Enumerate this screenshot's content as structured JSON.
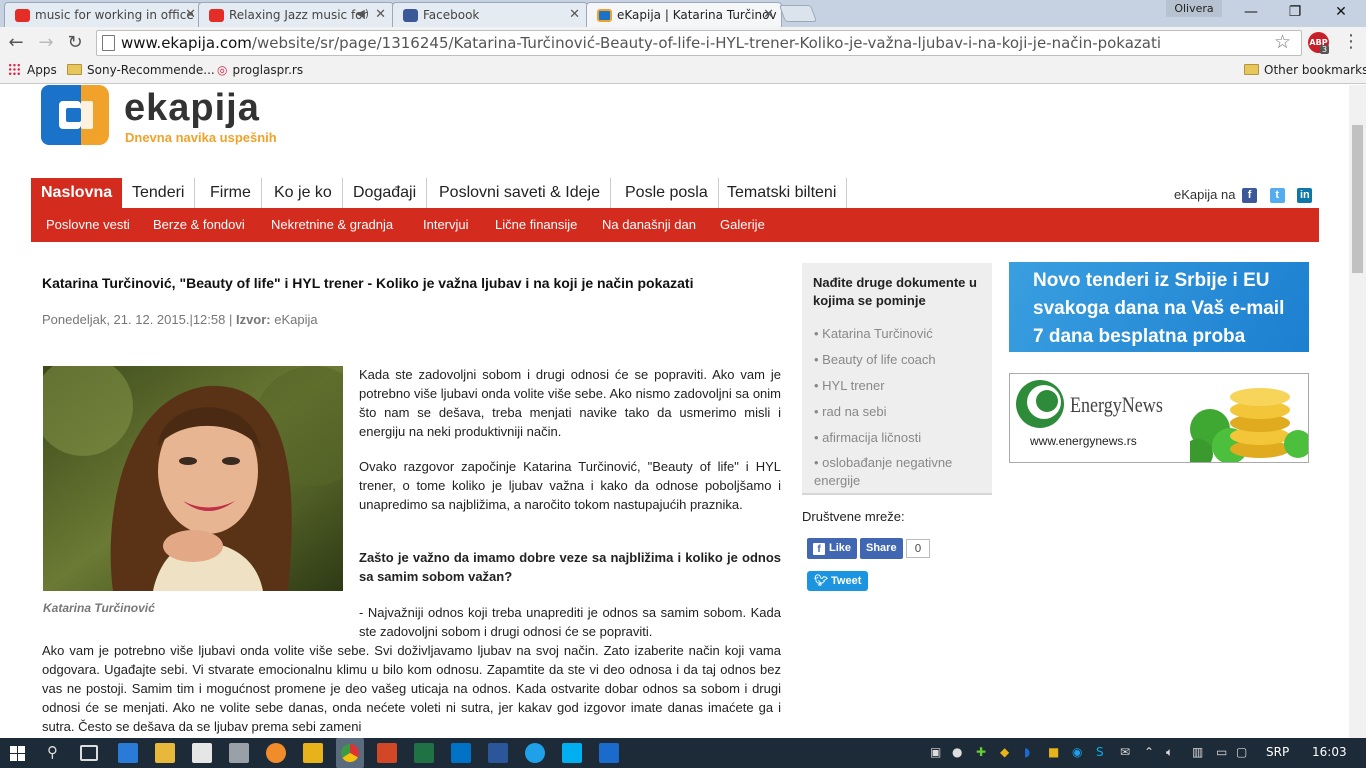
{
  "browser": {
    "tabs": [
      {
        "title": "music for working in office",
        "icon_color": "#e52d27"
      },
      {
        "title": "Relaxing Jazz music for",
        "icon_color": "#e52d27"
      },
      {
        "title": "Facebook",
        "icon_color": "#3b5998"
      },
      {
        "title": "eKapija | Katarina Turčinov",
        "icon_color": "#1a73c9"
      }
    ],
    "profile": "Olivera",
    "url_host": "www.ekapija.com",
    "url_path": "/website/sr/page/1316245/Katarina-Turčinović-Beauty-of-life-i-HYL-trener-Koliko-je-važna-ljubav-i-na-koji-je-način-pokazati",
    "abp_label": "ABP",
    "abp_count": "3",
    "bookmarks": {
      "apps": "Apps",
      "sony": "Sony-Recommende...",
      "proglas": "proglaspr.rs",
      "other": "Other bookmarks"
    }
  },
  "site": {
    "logo_text": "ekapija",
    "tagline": "Dnevna navika uspešnih",
    "nav": [
      "Naslovna",
      "Tenderi",
      "Firme",
      "Ko je ko",
      "Događaji",
      "Poslovni saveti & Ideje",
      "Posle posla",
      "Tematski bilteni"
    ],
    "social_label": "eKapija na",
    "subnav": [
      "Poslovne vesti",
      "Berze & fondovi",
      "Nekretnine & gradnja",
      "Intervjui",
      "Lične finansije",
      "Na današnji dan",
      "Galerije"
    ],
    "colors": {
      "brand_red": "#d32b1e",
      "brand_blue": "#1a73c9",
      "brand_orange": "#f0a22b"
    }
  },
  "article": {
    "title": "Katarina Turčinović, \"Beauty of life\" i HYL trener - Koliko je važna ljubav i na koji je način pokazati",
    "date": "Ponedeljak, 21. 12. 2015.|12:58",
    "sep": " | ",
    "source_label": "Izvor:",
    "source": "eKapija",
    "caption": "Katarina Turčinović",
    "p1": "Kada ste zadovoljni sobom i drugi odnosi će se popraviti. Ako vam je potrebno više ljubavi onda volite više sebe. Ako nismo zadovoljni sa onim što nam se dešava, treba menjati navike tako da usmerimo misli i energiju na neki produktivniji način.",
    "p2": "Ovako razgovor započinje Katarina Turčinović, \"Beauty of life\" i HYL trener, o tome koliko je ljubav važna i kako da odnose poboljšamo i unapredimo sa najbližima, a naročito tokom nastupajućih praznika.",
    "q1": "Zašto je važno da imamo dobre veze sa najbližima i koliko je odnos sa samim sobom važan?",
    "p3a": "- Najvažniji odnos koji treba unaprediti je odnos sa samim sobom. Kada ste zadovoljni sobom i drugi odnosi će se popraviti.",
    "p3b": "Ako vam je potrebno više ljubavi onda volite više sebe. Svi doživljavamo ljubav na svoj način. Zato izaberite način koji vama odgovara. Ugađajte sebi. Vi stvarate emocionalnu klimu u bilo kom odnosu. Zapamtite da ste vi deo odnosa i da taj odnos bez vas ne postoji. Samim tim i mogućnost promene je deo vašeg uticaja na odnos. Kada ostvarite dobar odnos sa sobom i drugi odnosi će se menjati. Ako ne volite sebe danas, onda nećete voleti ni sutra, jer kakav god izgovor imate danas imaćete ga i sutra. Često se dešava da se ljubav prema sebi zameni"
  },
  "sidebar": {
    "box_title": "Nađite druge dokumente u kojima se pominje",
    "links": [
      "Katarina Turčinović",
      "Beauty of life coach",
      "HYL trener",
      "rad na sebi",
      "afirmacija ličnosti",
      "oslobađanje negativne energije"
    ],
    "share_label": "Društvene mreže:",
    "like": "Like",
    "share": "Share",
    "share_count": "0",
    "tweet": "Tweet",
    "ad_tenderi": [
      "Novo tenderi iz Srbije i EU",
      "svakoga dana na Vaš e-mail",
      "7 dana besplatna proba"
    ],
    "ad_energy_title": "EnergyNews",
    "ad_energy_url": "www.energynews.rs"
  },
  "taskbar": {
    "lang": "SRP",
    "time": "16:03"
  }
}
